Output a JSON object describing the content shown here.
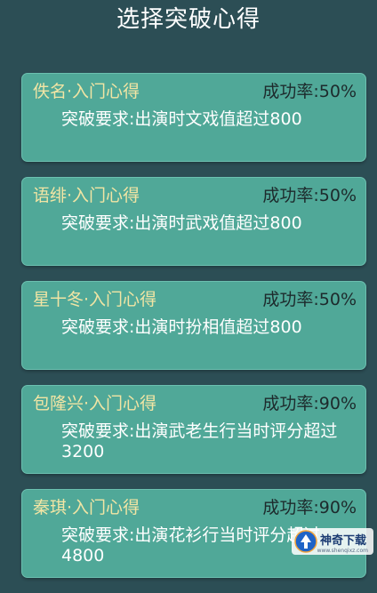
{
  "title": "选择突破心得",
  "cards": [
    {
      "name": "佚名·入门心得",
      "rate": "成功率:50%",
      "requirement": "突破要求:出演时文戏值超过800"
    },
    {
      "name": "语绯·入门心得",
      "rate": "成功率:50%",
      "requirement": "突破要求:出演时武戏值超过800"
    },
    {
      "name": "星十冬·入门心得",
      "rate": "成功率:50%",
      "requirement": "突破要求:出演时扮相值超过800"
    },
    {
      "name": "包隆兴·入门心得",
      "rate": "成功率:90%",
      "requirement": "突破要求:出演武老生行当时评分超过3200"
    },
    {
      "name": "秦琪·入门心得",
      "rate": "成功率:90%",
      "requirement": "突破要求:出演花衫行当时评分超过4800"
    }
  ],
  "watermark": {
    "text": "神奇下载",
    "url": "www.shenqixz.com",
    "icon": "shenqi-logo-icon"
  },
  "colors": {
    "background": "#2c4e55",
    "card": "#50a898",
    "name": "#f2e5a4",
    "rate": "#1d2a2c",
    "requirement": "#ffffff"
  }
}
